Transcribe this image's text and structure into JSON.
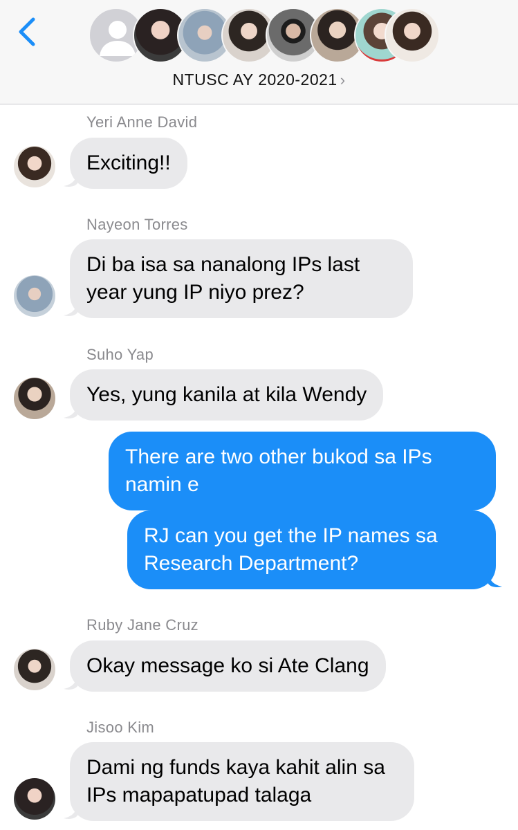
{
  "header": {
    "group_name": "NTUSC AY 2020-2021",
    "chevron": "›",
    "back_icon": "chevron-left-icon",
    "accent": "#1b8ef8"
  },
  "messages": [
    {
      "sender": "Yeri Anne David",
      "text": "Exciting!!",
      "direction": "incoming"
    },
    {
      "sender": "Nayeon Torres",
      "text": "Di ba isa sa nanalong IPs last year yung IP niyo prez?",
      "direction": "incoming"
    },
    {
      "sender": "Suho Yap",
      "text": "Yes, yung kanila at kila Wendy",
      "direction": "incoming"
    },
    {
      "sender": "",
      "text": "There are two other bukod sa IPs namin e",
      "direction": "outgoing"
    },
    {
      "sender": "",
      "text": "RJ can you get the IP names sa Research Department?",
      "direction": "outgoing"
    },
    {
      "sender": "Ruby Jane Cruz",
      "text": "Okay message ko si Ate Clang",
      "direction": "incoming"
    },
    {
      "sender": "Jisoo Kim",
      "text": "Dami ng funds kaya kahit alin sa IPs mapapatupad talaga",
      "direction": "incoming"
    }
  ],
  "colors": {
    "incoming_bubble": "#e9e9eb",
    "outgoing_bubble": "#1b8ef8",
    "sender_label": "#8a8a8e"
  }
}
